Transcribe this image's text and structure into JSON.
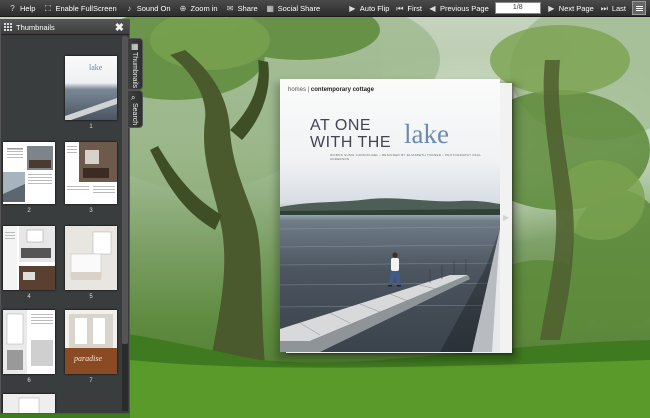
{
  "toolbar": {
    "help": "Help",
    "fullscreen": "Enable FullScreen",
    "sound": "Sound On",
    "zoom": "Zoom in",
    "share": "Share",
    "social_share": "Social Share",
    "auto_flip": "Auto Flip",
    "first": "First",
    "previous": "Previous Page",
    "page_indicator": "1/8",
    "next": "Next Page",
    "last": "Last"
  },
  "panel": {
    "title": "Thumbnails",
    "close": "✖",
    "tabs": [
      "Thumbnails",
      "Search"
    ],
    "thumbnails": [
      {
        "num": "1",
        "word": "lake"
      },
      {
        "num": "2"
      },
      {
        "num": "3"
      },
      {
        "num": "4"
      },
      {
        "num": "5"
      },
      {
        "num": "6"
      },
      {
        "num": "7",
        "word": "paradise"
      }
    ]
  },
  "page": {
    "section": "homes",
    "separator": " | ",
    "category": "contemporary cottage",
    "title_line1": "AT ONE",
    "title_line2": "WITH THE",
    "title_word": "lake",
    "credits": "WORDS SUSIE CARMICHAEL • DESIGNED BY ELIZABETH TURNER • PHOTOGRAPHY PAUL ANDERSON"
  },
  "colors": {
    "toolbar": "#2c2c2c",
    "panel": "#3a3d3d",
    "title_accent": "#6a8ab0"
  }
}
